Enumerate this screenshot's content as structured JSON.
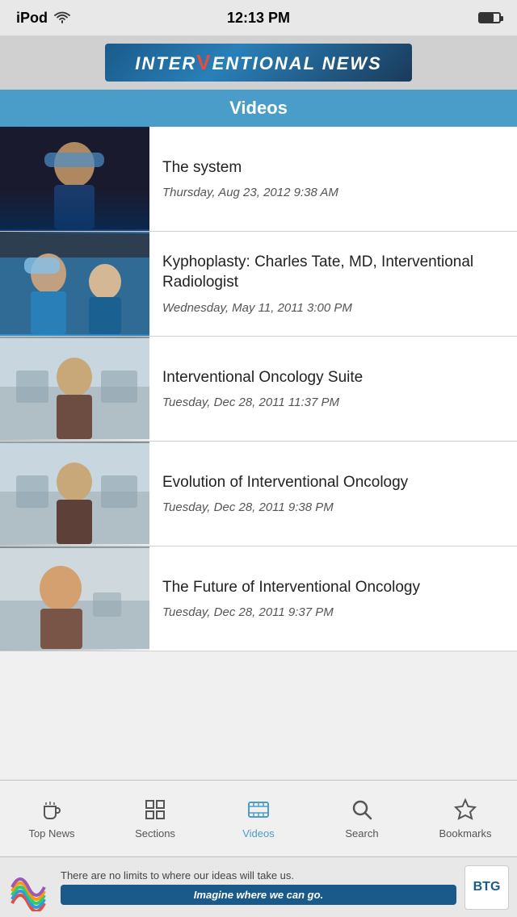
{
  "statusBar": {
    "device": "iPod",
    "time": "12:13 PM",
    "wifi": true
  },
  "header": {
    "logoText1": "INTER",
    "logoSlash": "/",
    "logoText2": "ENTIONAL NEWS"
  },
  "sectionHeader": {
    "title": "Videos"
  },
  "videos": [
    {
      "id": 1,
      "title": "The system",
      "date": "Thursday, Aug 23, 2012 9:38 AM",
      "thumbStyle": "thumb-1"
    },
    {
      "id": 2,
      "title": "Kyphoplasty: Charles Tate, MD, Interventional Radiologist",
      "date": "Wednesday, May 11, 2011 3:00 PM",
      "thumbStyle": "thumb-2"
    },
    {
      "id": 3,
      "title": "Interventional Oncology Suite",
      "date": "Tuesday, Dec 28, 2011 11:37 PM",
      "thumbStyle": "thumb-3"
    },
    {
      "id": 4,
      "title": "Evolution of Interventional Oncology",
      "date": "Tuesday, Dec 28, 2011 9:38 PM",
      "thumbStyle": "thumb-4"
    },
    {
      "id": 5,
      "title": "The Future of Interventional Oncology",
      "date": "Tuesday, Dec 28, 2011 9:37 PM",
      "thumbStyle": "thumb-5"
    }
  ],
  "tabBar": {
    "tabs": [
      {
        "id": "top-news",
        "label": "Top News",
        "icon": "coffee"
      },
      {
        "id": "sections",
        "label": "Sections",
        "icon": "grid"
      },
      {
        "id": "videos",
        "label": "Videos",
        "icon": "film",
        "active": true
      },
      {
        "id": "search",
        "label": "Search",
        "icon": "search"
      },
      {
        "id": "bookmarks",
        "label": "Bookmarks",
        "icon": "star"
      }
    ]
  },
  "adBanner": {
    "topText": "There are no limits to where our ideas will take us.",
    "buttonText": "Imagine where we can go.",
    "brandText": "BTG"
  }
}
